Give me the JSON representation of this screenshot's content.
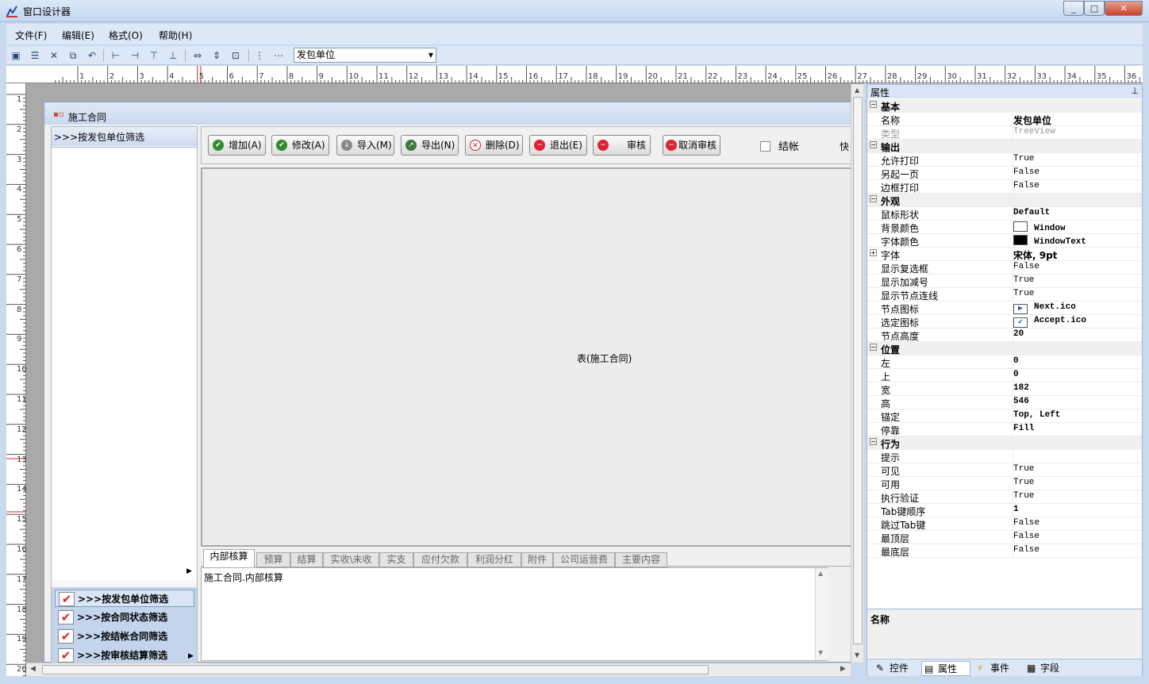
{
  "window": {
    "title": "窗口设计器",
    "min": "_",
    "max": "□",
    "close": "✕"
  },
  "menu": [
    "文件(F)",
    "编辑(E)",
    "格式(O)",
    "帮助(H)"
  ],
  "toolbar": {
    "icons": [
      "save-icon",
      "save-all-icon",
      "delete-icon",
      "copy-icon",
      "undo-icon",
      "align-left-icon",
      "align-right-icon",
      "align-top-icon",
      "align-bottom-icon",
      "same-width-icon",
      "same-height-icon",
      "same-size-icon",
      "center-vertical-icon",
      "center-horizontal-icon"
    ],
    "field_combo": "发包单位"
  },
  "ruler": {
    "h": [
      "1",
      "2",
      "3",
      "4",
      "5",
      "6",
      "7",
      "8",
      "9",
      "10",
      "11",
      "12",
      "13",
      "14",
      "15",
      "16",
      "17",
      "18",
      "19",
      "20",
      "21",
      "22",
      "23",
      "24",
      "25",
      "26",
      "27",
      "28",
      "29",
      "30",
      "31",
      "32",
      "33",
      "34",
      "35",
      "36"
    ],
    "v": [
      "1",
      "2",
      "3",
      "4",
      "5",
      "6",
      "7",
      "8",
      "9",
      "10",
      "11",
      "12",
      "13",
      "14",
      "15",
      "16",
      "17",
      "18",
      "19",
      "20"
    ]
  },
  "form": {
    "title": "施工合同",
    "left_head": ">>>按发包单位筛选",
    "filters": [
      ">>>按发包单位筛选",
      ">>>按合同状态筛选",
      ">>>按结帐合同筛选",
      ">>>按审核结算筛选"
    ],
    "buttons": [
      "增加(A)",
      "修改(A)",
      "导入(M)",
      "导出(N)",
      "删除(D)",
      "退出(E)",
      "审核",
      "取消审核"
    ],
    "checkbox_label": "结帐",
    "kuai": "快",
    "table_label": "表(施工合同)",
    "tabs": [
      "内部核算",
      "预算",
      "结算",
      "实收\\未收",
      "实支",
      "应付欠款",
      "利润分红",
      "附件",
      "公司运营费",
      "主要内容"
    ],
    "tab_content": "施工合同.内部核算"
  },
  "properties": {
    "header": "属性",
    "rows": [
      {
        "cat": true,
        "k": "基本"
      },
      {
        "k": "名称",
        "v": "发包单位"
      },
      {
        "k": "类型",
        "v": "TreeView",
        "dim": true
      },
      {
        "cat": true,
        "k": "输出"
      },
      {
        "k": "允许打印",
        "v": "True"
      },
      {
        "k": "另起一页",
        "v": "False"
      },
      {
        "k": "边框打印",
        "v": "False"
      },
      {
        "cat": true,
        "k": "外观"
      },
      {
        "k": "鼠标形状",
        "v": "Default"
      },
      {
        "k": "背景颜色",
        "v": "Window",
        "swatch": "#ffffff"
      },
      {
        "k": "字体颜色",
        "v": "WindowText",
        "swatch": "#000000"
      },
      {
        "k": "字体",
        "v": "宋体, 9pt",
        "plus": true
      },
      {
        "k": "显示复选框",
        "v": "False"
      },
      {
        "k": "显示加减号",
        "v": "True"
      },
      {
        "k": "显示节点连线",
        "v": "True"
      },
      {
        "k": "节点图标",
        "v": "Next.ico",
        "icon": "▶"
      },
      {
        "k": "选定图标",
        "v": "Accept.ico",
        "icon": "✔"
      },
      {
        "k": "节点高度",
        "v": "20"
      },
      {
        "cat": true,
        "k": "位置"
      },
      {
        "k": "左",
        "v": "0"
      },
      {
        "k": "上",
        "v": "0"
      },
      {
        "k": "宽",
        "v": "182"
      },
      {
        "k": "高",
        "v": "546"
      },
      {
        "k": "锚定",
        "v": "Top, Left"
      },
      {
        "k": "停靠",
        "v": "Fill"
      },
      {
        "cat": true,
        "k": "行为"
      },
      {
        "k": "提示",
        "v": ""
      },
      {
        "k": "可见",
        "v": "True"
      },
      {
        "k": "可用",
        "v": "True"
      },
      {
        "k": "执行验证",
        "v": "True"
      },
      {
        "k": "Tab键顺序",
        "v": "1"
      },
      {
        "k": "跳过Tab键",
        "v": "False"
      },
      {
        "k": "最顶层",
        "v": "False"
      },
      {
        "k": "最底层",
        "v": "False"
      }
    ],
    "desc_title": "名称",
    "tabs": [
      "控件",
      "属性",
      "事件",
      "字段"
    ]
  }
}
